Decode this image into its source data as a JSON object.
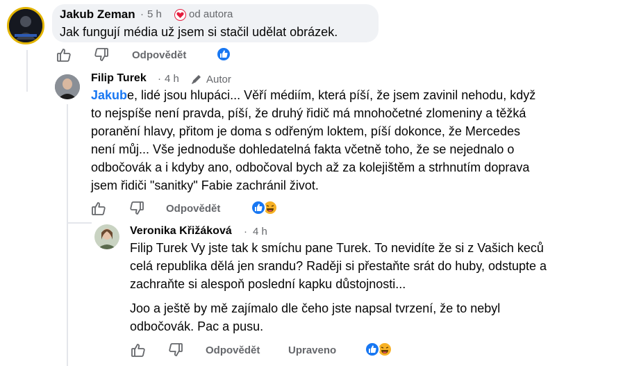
{
  "comments": [
    {
      "author": "Jakub Zeman",
      "time": "5 h",
      "badge": "od autora",
      "lines": [
        "Jak fungují média už jsem si stačil udělat obrázek."
      ],
      "reply_label": "Odpovědět",
      "reactions": [
        "like"
      ]
    },
    {
      "author": "Filip Turek",
      "time": "4 h",
      "badge": "Autor",
      "mention": "Jakub",
      "first_line_rest": "e, lidé jsou hlupáci... Věří médiím, která píší, že jsem zavinil nehodu, když",
      "lines": [
        "to nejspíše není pravda, píší, že druhý řidič má mnohočetné zlomeniny a těžká",
        "poranění hlavy, přitom je doma s odřeným loktem, píší dokonce, že Mercedes",
        "není můj... Vše jednoduše dohledatelná fakta včetně toho, že se nejednalo o",
        "odbočovák a i kdyby ano, odbočoval bych až za kolejištěm a strhnutím doprava",
        "jsem řidiči \"sanitky\" Fabie zachránil život."
      ],
      "reply_label": "Odpovědět",
      "reactions": [
        "like",
        "haha"
      ]
    },
    {
      "author": "Veronika Křižáková",
      "time": "4 h",
      "paragraph1": [
        "Filip Turek Vy jste tak k smíchu pane Turek. To nevidíte že si z Vašich keců",
        "celá republika dělá jen srandu? Raději si přestaňte srát do huby, odstupte a",
        "zachraňte si alespoň poslední kapku důstojnosti..."
      ],
      "paragraph2": [
        "Joo a ještě by mě zajímalo dle čeho jste napsal tvrzení, že to nebyl",
        "odbočovák. Pac a pusu."
      ],
      "reply_label": "Odpovědět",
      "edited_label": "Upraveno",
      "reactions": [
        "like",
        "haha"
      ]
    }
  ],
  "colors": {
    "accent": "#1877f2",
    "muted": "#65676b",
    "bubble": "#f0f2f5",
    "heart": "#e41e3f"
  },
  "icons": [
    "like-outline-icon",
    "dislike-outline-icon",
    "heart-icon",
    "pencil-icon",
    "like-reaction-icon",
    "haha-reaction-icon"
  ]
}
